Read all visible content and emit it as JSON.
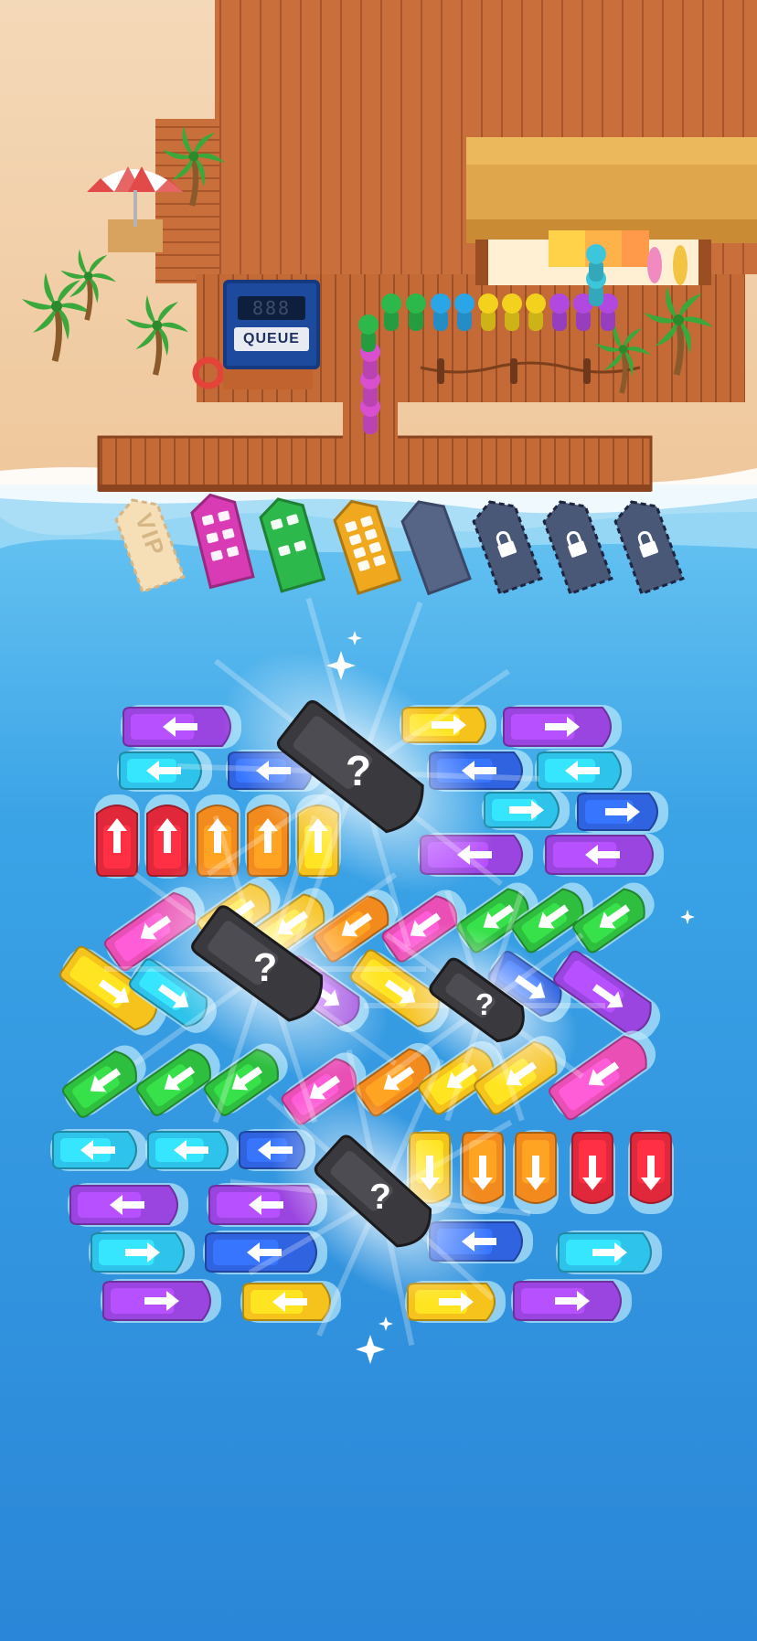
{
  "queue_board": {
    "display": "888",
    "label": "QUEUE"
  },
  "dock_slots": {
    "vip_label": "VIP",
    "slots": [
      {
        "state": "vip-empty"
      },
      {
        "state": "boat",
        "color": "#d93bb5",
        "seats": 6
      },
      {
        "state": "boat",
        "color": "#2cb84a",
        "seats": 4
      },
      {
        "state": "boat",
        "color": "#f0a91e",
        "seats": 8
      },
      {
        "state": "empty"
      },
      {
        "state": "locked",
        "icon": "lock-icon"
      },
      {
        "state": "locked",
        "icon": "lock-icon"
      },
      {
        "state": "locked",
        "icon": "lock-icon"
      }
    ]
  },
  "passenger_queue": {
    "colors": [
      "#d84fd0",
      "#d84fd0",
      "#d84fd0",
      "#2cb84a",
      "#2cb84a",
      "#2cb84a",
      "#2aa6e8",
      "#2aa6e8",
      "#f2d21c",
      "#f2d21c",
      "#f2d21c",
      "#b149e0",
      "#b149e0",
      "#b149e0",
      "#3cc6dc",
      "#3cc6dc"
    ]
  },
  "mystery_boat_symbol": "?",
  "colors": {
    "purple": "#9b45e0",
    "cyan": "#2ec3ea",
    "blue": "#2f63e0",
    "red": "#e0283a",
    "orange": "#f28a1e",
    "yellow": "#f6c21c",
    "green": "#2fbf3f",
    "pink": "#ea4fb6",
    "mystery": "#3a3a3e",
    "water": "#3aa3e6",
    "sand": "#f1cfa6",
    "wood": "#c8703e"
  }
}
